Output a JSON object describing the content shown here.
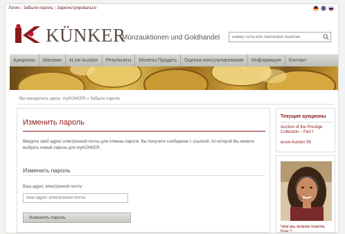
{
  "topbar": {
    "links": [
      "Логин",
      "Забыли пароль",
      "Зарегистрироваться"
    ]
  },
  "header": {
    "logo_text": "KÜNKER",
    "logo_subtitle": "Münzauktionen und Goldhandel",
    "search_placeholder": "номер лота или поисковое понятие"
  },
  "nav": {
    "items": [
      "Аукционы",
      "Магазин",
      "eLive Auction",
      "Результаты",
      "Монеты Продать",
      "Оценка-консультирование",
      "Информация",
      "Контакт"
    ]
  },
  "breadcrumb": {
    "home": "Вы находитесь здесь: myKÜNKER",
    "sep": "»",
    "current": "Забыли пароль"
  },
  "main": {
    "title": "Изменить пароль",
    "intro": "Введите свой адрес электронной почты для отмены пароля. Вы получите сообщение с ссылкой, по которой Вы можете выбрать новый пароль для myKÜNKER.",
    "section_title": "Изменить пароль",
    "email_label": "Ваш адрес электронной почты",
    "email_placeholder": "Ваш адрес электронной почты",
    "submit_label": "Изменить пароль"
  },
  "sidebar": {
    "title": "Текущие аукционы",
    "links": [
      "Auction of the Prestige Collection – Part I",
      "eLive Auction 55"
    ],
    "caption": "Чем мы можем помочь Вам ?"
  },
  "colors": {
    "brand": "#8b1a1a",
    "logo": "#5a4b42",
    "nav_bg": "#cfcfca"
  }
}
